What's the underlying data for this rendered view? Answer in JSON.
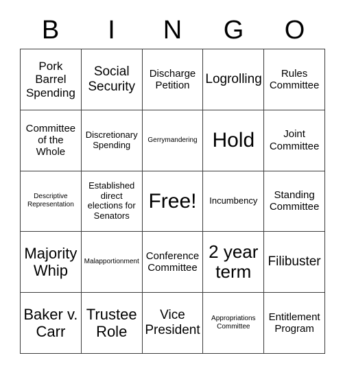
{
  "card": {
    "header_letters": [
      "B",
      "I",
      "N",
      "G",
      "O"
    ],
    "grid_size": 5,
    "text_color": "#000000",
    "border_color": "#3b3b3b",
    "background_color": "#ffffff",
    "cells": [
      {
        "text": "Pork Barrel Spending",
        "size": "lg"
      },
      {
        "text": "Social Security",
        "size": "xl"
      },
      {
        "text": "Discharge Petition",
        "size": "md"
      },
      {
        "text": "Logrolling",
        "size": "xl"
      },
      {
        "text": "Rules Committee",
        "size": "md"
      },
      {
        "text": "Committee of the Whole",
        "size": "md"
      },
      {
        "text": "Discretionary Spending",
        "size": "sm"
      },
      {
        "text": "Gerrymandering",
        "size": "xs"
      },
      {
        "text": "Hold",
        "size": "4xl"
      },
      {
        "text": "Joint Committee",
        "size": "md"
      },
      {
        "text": "Descriptive Representation",
        "size": "xs"
      },
      {
        "text": "Established direct elections for Senators",
        "size": "sm"
      },
      {
        "text": "Free!",
        "size": "4xl"
      },
      {
        "text": "Incumbency",
        "size": "sm"
      },
      {
        "text": "Standing Committee",
        "size": "md"
      },
      {
        "text": "Majority Whip",
        "size": "2xl"
      },
      {
        "text": "Malapportionment",
        "size": "xs"
      },
      {
        "text": "Conference Committee",
        "size": "md"
      },
      {
        "text": "2 year term",
        "size": "3xl"
      },
      {
        "text": "Filibuster",
        "size": "xl"
      },
      {
        "text": "Baker v. Carr",
        "size": "2xl"
      },
      {
        "text": "Trustee Role",
        "size": "2xl"
      },
      {
        "text": "Vice President",
        "size": "xl"
      },
      {
        "text": "Appropriations Committee",
        "size": "xs"
      },
      {
        "text": "Entitlement Program",
        "size": "md"
      }
    ]
  }
}
